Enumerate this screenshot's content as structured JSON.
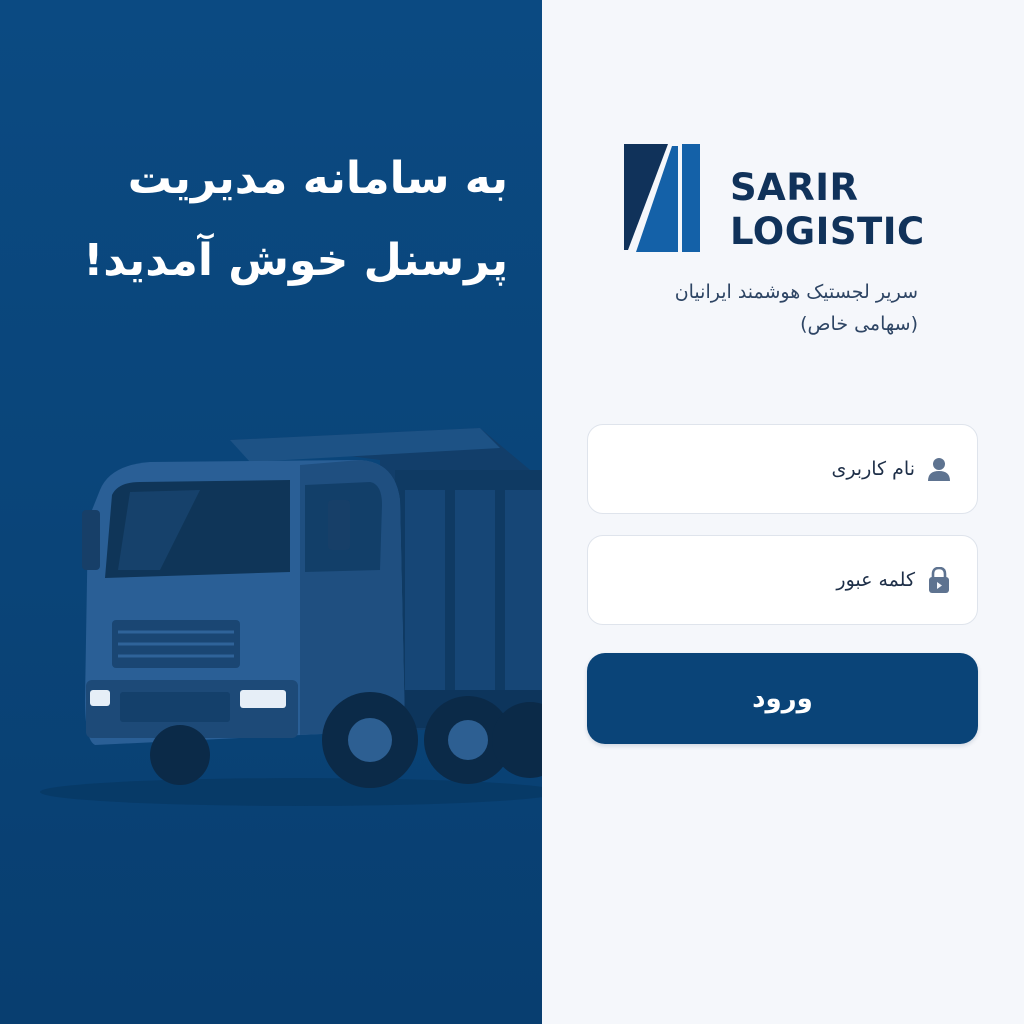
{
  "welcome": {
    "line1": "به سامانه مدیریت",
    "line2": "پرسنل خوش آمدید!"
  },
  "brand": {
    "line1": "SARIR",
    "line2": "LOGISTIC",
    "company_line1": "سریر لجستیک هوشمند ایرانیان",
    "company_line2": "(سهامی خاص)"
  },
  "form": {
    "username_label": "نام کاربری",
    "password_label": "کلمه عبور",
    "submit_label": "ورود",
    "username_icon": "user-icon",
    "password_icon": "lock-icon"
  },
  "colors": {
    "primary": "#0a4478",
    "panel_bg": "#f5f7fb",
    "text_dark": "#10325a"
  }
}
